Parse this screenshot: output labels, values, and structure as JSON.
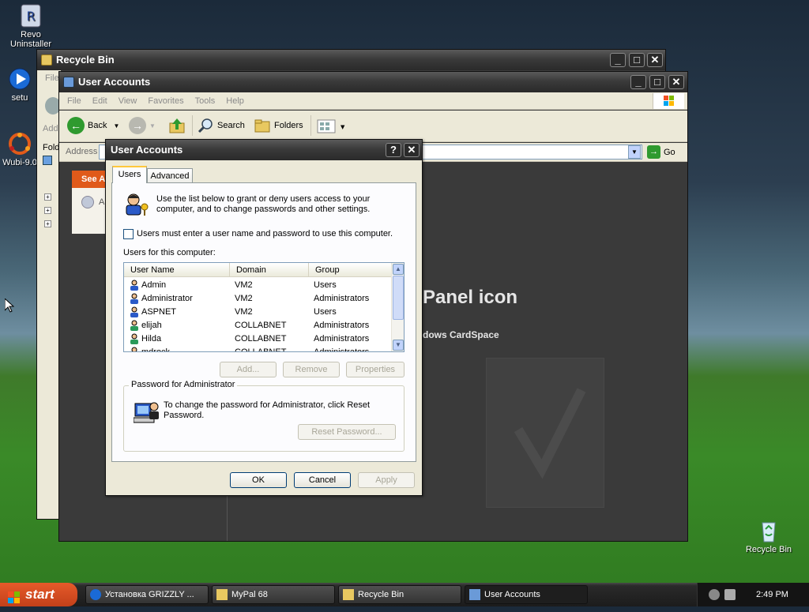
{
  "desktop": {
    "icons": [
      {
        "label_line1": "Revo",
        "label_line2": "Uninstaller",
        "icon": "revo-uninstaller-icon"
      },
      {
        "label": "setu",
        "icon": "setup-icon"
      },
      {
        "label": "Wubi-9.0",
        "icon": "wubi-icon"
      },
      {
        "label": "Recycle Bin",
        "icon": "recycle-bin-icon"
      }
    ]
  },
  "recycle_window": {
    "title": "Recycle Bin",
    "menu_partial": "File",
    "address_partial": "Add",
    "folders_partial": "Fold"
  },
  "ua_window": {
    "title": "User Accounts",
    "menu": [
      "File",
      "Edit",
      "View",
      "Favorites",
      "Tools",
      "Help"
    ],
    "toolbar": {
      "back": "Back",
      "search": "Search",
      "folders": "Folders"
    },
    "address_label": "Address",
    "go_label": "Go",
    "see_also": "See A",
    "content_heading": "Panel icon",
    "content_sub": "dows CardSpace"
  },
  "dialog": {
    "title": "User Accounts",
    "help_btn": "?",
    "close_btn": "✕",
    "tabs": [
      "Users",
      "Advanced"
    ],
    "intro": "Use the list below to grant or deny users access to your computer, and to change passwords and other settings.",
    "checkbox_label": "Users must enter a user name and password to use this computer.",
    "checkbox_checked": false,
    "users_label": "Users for this computer:",
    "columns": [
      "User Name",
      "Domain",
      "Group"
    ],
    "users": [
      {
        "name": "Admin",
        "domain": "VM2",
        "group": "Users"
      },
      {
        "name": "Administrator",
        "domain": "VM2",
        "group": "Administrators"
      },
      {
        "name": "ASPNET",
        "domain": "VM2",
        "group": "Users"
      },
      {
        "name": "elijah",
        "domain": "COLLABNET",
        "group": "Administrators"
      },
      {
        "name": "Hilda",
        "domain": "COLLABNET",
        "group": "Administrators"
      },
      {
        "name": "mdrock",
        "domain": "COLLABNET",
        "group": "Administrators"
      }
    ],
    "buttons": {
      "add": "Add...",
      "remove": "Remove",
      "properties": "Properties"
    },
    "password_group": "Password for Administrator",
    "password_text": "To change the password for Administrator, click Reset Password.",
    "reset_password": "Reset Password...",
    "ok": "OK",
    "cancel": "Cancel",
    "apply": "Apply"
  },
  "taskbar": {
    "start": "start",
    "tasks": [
      {
        "label": "Установка GRIZZLY ...",
        "icon": "installer-icon"
      },
      {
        "label": "MyPal 68",
        "icon": "folder-icon"
      },
      {
        "label": "Recycle Bin",
        "icon": "folder-icon"
      },
      {
        "label": "User Accounts",
        "icon": "user-accounts-icon"
      }
    ],
    "clock": "2:49 PM"
  }
}
